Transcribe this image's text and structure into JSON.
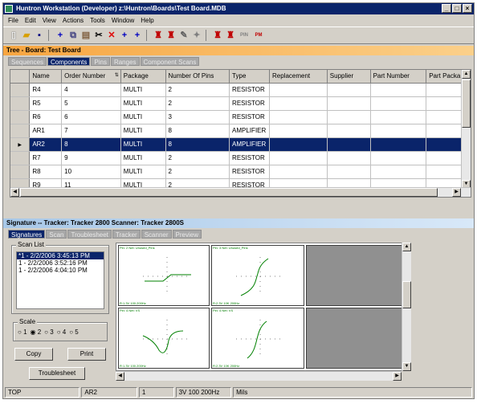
{
  "window": {
    "title": "Huntron Workstation (Developer)  z:\\Huntron\\Boards\\Test Board.MDB",
    "controls": [
      "_",
      "□",
      "×"
    ]
  },
  "menu": [
    "File",
    "Edit",
    "View",
    "Actions",
    "Tools",
    "Window",
    "Help"
  ],
  "toolbar": {
    "buttons": [
      {
        "name": "new",
        "glyph": "▯"
      },
      {
        "name": "open",
        "glyph": "▰"
      },
      {
        "name": "save",
        "glyph": "▪"
      },
      {
        "name": "add",
        "glyph": "+"
      },
      {
        "name": "copy",
        "glyph": "⧉"
      },
      {
        "name": "paste",
        "glyph": "▤"
      },
      {
        "name": "cut",
        "glyph": "✂"
      },
      {
        "name": "delete",
        "glyph": "✕"
      },
      {
        "name": "add-pin",
        "glyph": "+"
      },
      {
        "name": "add-multi",
        "glyph": "+"
      },
      {
        "name": "probe1",
        "glyph": "♜"
      },
      {
        "name": "probe2",
        "glyph": "♜"
      },
      {
        "name": "probe3",
        "glyph": "✎"
      },
      {
        "name": "probe4",
        "glyph": "✦"
      },
      {
        "name": "test1",
        "glyph": "♜"
      },
      {
        "name": "test2",
        "glyph": "♜"
      },
      {
        "name": "pin",
        "glyph": "PIN"
      },
      {
        "name": "pm",
        "glyph": "PM"
      }
    ]
  },
  "tree": {
    "header": "Tree - Board: Test Board",
    "tabs": [
      "Sequences",
      "Components",
      "Pins",
      "Ranges",
      "Component Scans"
    ],
    "active_tab": "Components",
    "columns": [
      "Name",
      "Order Number",
      "Package",
      "Number Of Pins",
      "Type",
      "Replacement",
      "Supplier",
      "Part Number",
      "Part Packa"
    ],
    "rows": [
      [
        "R4",
        "4",
        "MULTI",
        "2",
        "RESISTOR",
        "",
        "",
        "",
        ""
      ],
      [
        "R5",
        "5",
        "MULTI",
        "2",
        "RESISTOR",
        "",
        "",
        "",
        ""
      ],
      [
        "R6",
        "6",
        "MULTI",
        "3",
        "RESISTOR",
        "",
        "",
        "",
        ""
      ],
      [
        "AR1",
        "7",
        "MULTI",
        "8",
        "AMPLIFIER",
        "",
        "",
        "",
        ""
      ],
      [
        "AR2",
        "8",
        "MULTI",
        "8",
        "AMPLIFIER",
        "",
        "",
        "",
        ""
      ],
      [
        "R7",
        "9",
        "MULTI",
        "2",
        "RESISTOR",
        "",
        "",
        "",
        ""
      ],
      [
        "R8",
        "10",
        "MULTI",
        "2",
        "RESISTOR",
        "",
        "",
        "",
        ""
      ],
      [
        "R9",
        "11",
        "MULTI",
        "2",
        "RESISTOR",
        "",
        "",
        "",
        ""
      ]
    ],
    "selected_row": 4
  },
  "signature": {
    "header": "Signature -- Tracker: Tracker 2800  Scanner: Tracker 2800S",
    "tabs": [
      "Signatures",
      "Scan",
      "Troublesheet",
      "Tracker",
      "Scanner",
      "Preview"
    ],
    "active_tab": "Signatures",
    "scan_list_label": "Scan List",
    "scans": [
      "*1 - 2/2/2006 3:45:13 PM",
      "1 - 2/2/2006 3:52:16 PM",
      "1 - 2/2/2006 4:04:10 PM"
    ],
    "selected_scan": 0,
    "scale_label": "Scale",
    "scale_options": [
      "1",
      "2",
      "3",
      "4",
      "5"
    ],
    "scale_selected": "2",
    "buttons": {
      "copy": "Copy",
      "print": "Print",
      "troublesheet": "Troublesheet"
    },
    "cells": [
      {
        "title": "Pin: 2  Net: Unused_Pins",
        "footer": "R:1.3V  100.200Hz"
      },
      {
        "title": "Pin: 3  Net: Unused_Pins",
        "footer": "R:2.3V  10K 200Hz"
      },
      {
        "title": "Pin: 4  Net: VS",
        "footer": "R:1.3V  100.200Hz"
      },
      {
        "title": "Pin: 4  Net: VS",
        "footer": "R:2.3V  10K 200Hz"
      }
    ]
  },
  "status": [
    "TOP",
    "AR2",
    "1",
    "3V 100 200Hz",
    "Mils"
  ]
}
